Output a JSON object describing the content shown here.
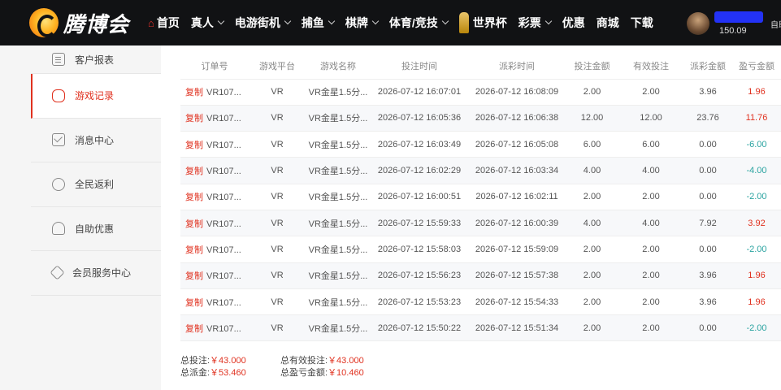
{
  "brand": {
    "name": "腾博会"
  },
  "nav": [
    {
      "label": "首页",
      "icon": "home-icon",
      "dropdown": false,
      "active": true
    },
    {
      "label": "真人",
      "dropdown": true
    },
    {
      "label": "电游街机",
      "dropdown": true
    },
    {
      "label": "捕鱼",
      "dropdown": true
    },
    {
      "label": "棋牌",
      "dropdown": true
    },
    {
      "label": "体育/竞技",
      "dropdown": true
    },
    {
      "label": "世界杯",
      "icon": "trophy-icon",
      "dropdown": false
    },
    {
      "label": "彩票",
      "dropdown": true
    },
    {
      "label": "优惠",
      "dropdown": false
    },
    {
      "label": "商城",
      "dropdown": false
    },
    {
      "label": "下载",
      "dropdown": false
    }
  ],
  "user": {
    "balance": "150.09",
    "more": "自助"
  },
  "sidebar": [
    {
      "label": "客户报表",
      "icon": "document-icon"
    },
    {
      "label": "游戏记录",
      "icon": "gamepad-icon",
      "active": true
    },
    {
      "label": "消息中心",
      "icon": "mail-icon"
    },
    {
      "label": "全民返利",
      "icon": "rebate-icon"
    },
    {
      "label": "自助优惠",
      "icon": "hand-gift-icon"
    },
    {
      "label": "会员服务中心",
      "icon": "diamond-icon"
    }
  ],
  "table": {
    "columns": [
      "订单号",
      "游戏平台",
      "游戏名称",
      "投注时间",
      "派彩时间",
      "投注金额",
      "有效投注",
      "派彩金额",
      "盈亏金额"
    ],
    "copy_label": "复制",
    "rows": [
      {
        "order": "VR107...",
        "platform": "VR",
        "game": "VR金星1.5分...",
        "bet_time": "2026-07-12 16:07:01",
        "payout_time": "2026-07-12 16:08:09",
        "bet": "2.00",
        "valid": "2.00",
        "payout": "3.96",
        "profit": "1.96",
        "sign": "pos"
      },
      {
        "order": "VR107...",
        "platform": "VR",
        "game": "VR金星1.5分...",
        "bet_time": "2026-07-12 16:05:36",
        "payout_time": "2026-07-12 16:06:38",
        "bet": "12.00",
        "valid": "12.00",
        "payout": "23.76",
        "profit": "11.76",
        "sign": "pos"
      },
      {
        "order": "VR107...",
        "platform": "VR",
        "game": "VR金星1.5分...",
        "bet_time": "2026-07-12 16:03:49",
        "payout_time": "2026-07-12 16:05:08",
        "bet": "6.00",
        "valid": "6.00",
        "payout": "0.00",
        "profit": "-6.00",
        "sign": "neg"
      },
      {
        "order": "VR107...",
        "platform": "VR",
        "game": "VR金星1.5分...",
        "bet_time": "2026-07-12 16:02:29",
        "payout_time": "2026-07-12 16:03:34",
        "bet": "4.00",
        "valid": "4.00",
        "payout": "0.00",
        "profit": "-4.00",
        "sign": "neg"
      },
      {
        "order": "VR107...",
        "platform": "VR",
        "game": "VR金星1.5分...",
        "bet_time": "2026-07-12 16:00:51",
        "payout_time": "2026-07-12 16:02:11",
        "bet": "2.00",
        "valid": "2.00",
        "payout": "0.00",
        "profit": "-2.00",
        "sign": "neg"
      },
      {
        "order": "VR107...",
        "platform": "VR",
        "game": "VR金星1.5分...",
        "bet_time": "2026-07-12 15:59:33",
        "payout_time": "2026-07-12 16:00:39",
        "bet": "4.00",
        "valid": "4.00",
        "payout": "7.92",
        "profit": "3.92",
        "sign": "pos"
      },
      {
        "order": "VR107...",
        "platform": "VR",
        "game": "VR金星1.5分...",
        "bet_time": "2026-07-12 15:58:03",
        "payout_time": "2026-07-12 15:59:09",
        "bet": "2.00",
        "valid": "2.00",
        "payout": "0.00",
        "profit": "-2.00",
        "sign": "neg"
      },
      {
        "order": "VR107...",
        "platform": "VR",
        "game": "VR金星1.5分...",
        "bet_time": "2026-07-12 15:56:23",
        "payout_time": "2026-07-12 15:57:38",
        "bet": "2.00",
        "valid": "2.00",
        "payout": "3.96",
        "profit": "1.96",
        "sign": "pos"
      },
      {
        "order": "VR107...",
        "platform": "VR",
        "game": "VR金星1.5分...",
        "bet_time": "2026-07-12 15:53:23",
        "payout_time": "2026-07-12 15:54:33",
        "bet": "2.00",
        "valid": "2.00",
        "payout": "3.96",
        "profit": "1.96",
        "sign": "pos"
      },
      {
        "order": "VR107...",
        "platform": "VR",
        "game": "VR金星1.5分...",
        "bet_time": "2026-07-12 15:50:22",
        "payout_time": "2026-07-12 15:51:34",
        "bet": "2.00",
        "valid": "2.00",
        "payout": "0.00",
        "profit": "-2.00",
        "sign": "neg"
      }
    ]
  },
  "summary": {
    "total_bet_label": "总投注:",
    "total_bet": "￥43.000",
    "total_valid_label": "总有效投注:",
    "total_valid": "￥43.000",
    "total_payout_label": "总派金:",
    "total_payout": "￥53.460",
    "total_profit_label": "总盈亏金额:",
    "total_profit": "￥10.460"
  },
  "colors": {
    "accent": "#e0311f",
    "positive": "#e0311f",
    "negative": "#2aa3a0",
    "topbar": "#111214"
  }
}
